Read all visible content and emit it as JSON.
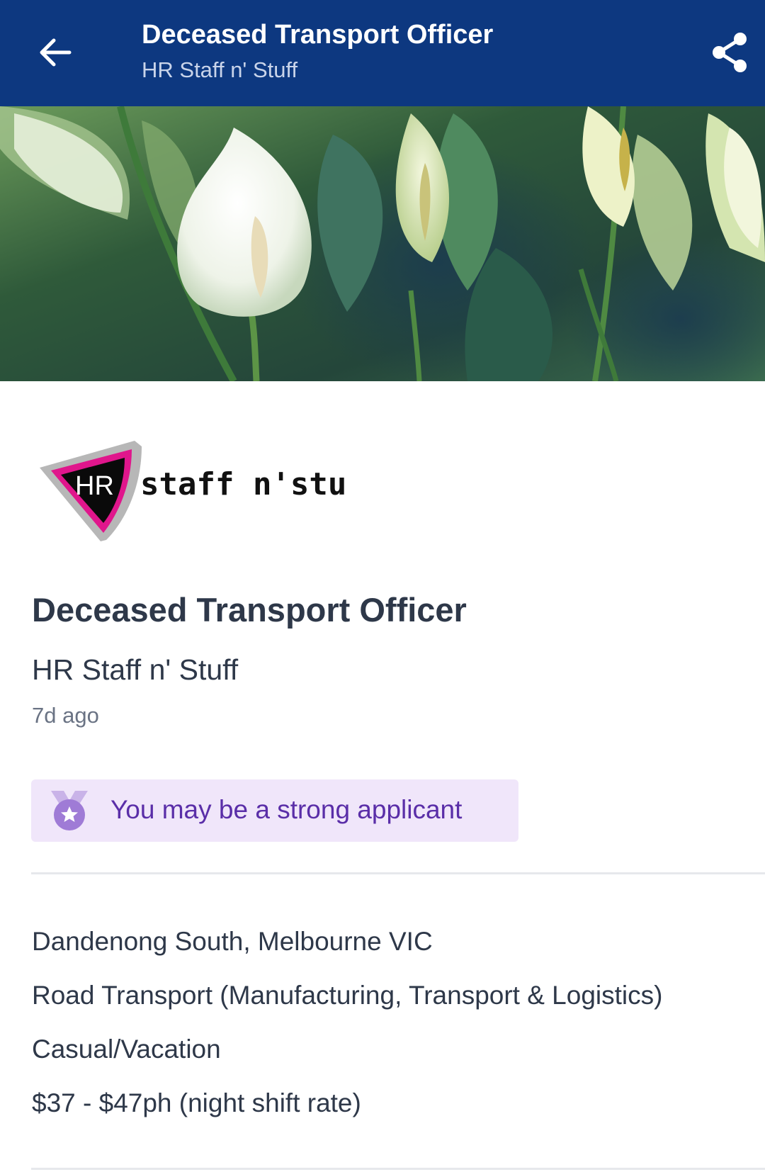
{
  "app_bar": {
    "title": "Deceased Transport Officer",
    "subtitle": "HR Staff n' Stuff",
    "back_icon": "arrow-left-icon",
    "share_icon": "share-icon",
    "background_color": "#0d3880"
  },
  "hero_image": {
    "description_icon": "peace-lily-photo"
  },
  "logo": {
    "badge_text": "HR",
    "wordmark": "staff n'stuff",
    "accent_color": "#e0168c"
  },
  "job": {
    "title": "Deceased Transport Officer",
    "company": "HR Staff n' Stuff",
    "posted": "7d ago"
  },
  "applicant_badge": {
    "icon": "medal-star-icon",
    "text": "You may be a strong applicant",
    "background_color": "#f0e6fa",
    "text_color": "#5a2ea8"
  },
  "details": {
    "location": "Dandenong South, Melbourne VIC",
    "category": "Road Transport (Manufacturing, Transport & Logistics)",
    "work_type": "Casual/Vacation",
    "salary": "$37 - $47ph (night shift rate)"
  }
}
